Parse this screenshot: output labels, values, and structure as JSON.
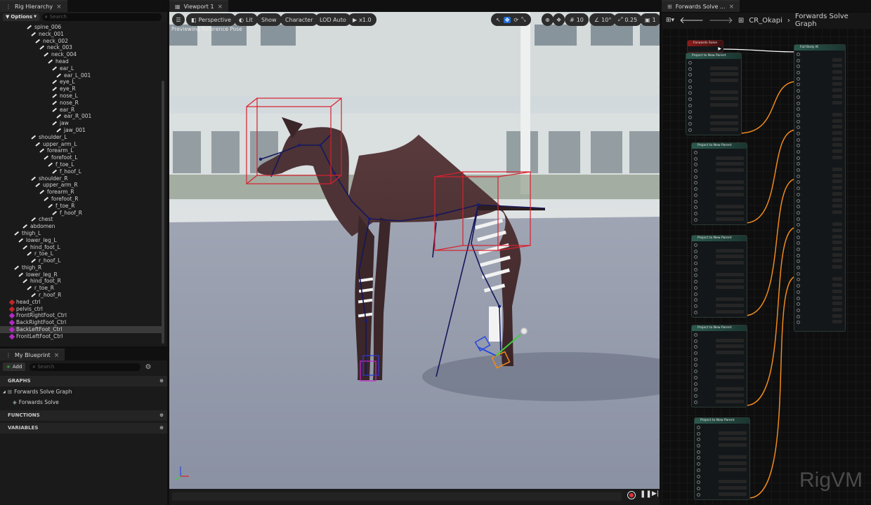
{
  "rig_hierarchy": {
    "tab_label": "Rig Hierarchy",
    "options_label": "Options",
    "search_placeholder": "Search",
    "bones": [
      {
        "label": "spine_006",
        "indent": 38
      },
      {
        "label": "neck_001",
        "indent": 44
      },
      {
        "label": "neck_002",
        "indent": 50
      },
      {
        "label": "neck_003",
        "indent": 56
      },
      {
        "label": "neck_004",
        "indent": 62
      },
      {
        "label": "head",
        "indent": 68
      },
      {
        "label": "ear_L",
        "indent": 74
      },
      {
        "label": "ear_L_001",
        "indent": 80
      },
      {
        "label": "eye_L",
        "indent": 74
      },
      {
        "label": "eye_R",
        "indent": 74
      },
      {
        "label": "nose_L",
        "indent": 74
      },
      {
        "label": "nose_R",
        "indent": 74
      },
      {
        "label": "ear_R",
        "indent": 74
      },
      {
        "label": "ear_R_001",
        "indent": 80
      },
      {
        "label": "jaw",
        "indent": 74
      },
      {
        "label": "jaw_001",
        "indent": 80
      },
      {
        "label": "shoulder_L",
        "indent": 44
      },
      {
        "label": "upper_arm_L",
        "indent": 50
      },
      {
        "label": "forearm_L",
        "indent": 56
      },
      {
        "label": "forefoot_L",
        "indent": 62
      },
      {
        "label": "f_toe_L",
        "indent": 68
      },
      {
        "label": "f_hoof_L",
        "indent": 74
      },
      {
        "label": "shoulder_R",
        "indent": 44
      },
      {
        "label": "upper_arm_R",
        "indent": 50
      },
      {
        "label": "forearm_R",
        "indent": 56
      },
      {
        "label": "forefoot_R",
        "indent": 62
      },
      {
        "label": "f_toe_R",
        "indent": 68
      },
      {
        "label": "f_hoof_R",
        "indent": 74
      },
      {
        "label": "chest",
        "indent": 44
      },
      {
        "label": "abdomen",
        "indent": 32
      },
      {
        "label": "thigh_L",
        "indent": 20
      },
      {
        "label": "lower_leg_L",
        "indent": 26
      },
      {
        "label": "hind_foot_L",
        "indent": 32
      },
      {
        "label": "r_toe_L",
        "indent": 38
      },
      {
        "label": "r_hoof_L",
        "indent": 44
      },
      {
        "label": "thigh_R",
        "indent": 20
      },
      {
        "label": "lower_leg_R",
        "indent": 26
      },
      {
        "label": "hind_foot_R",
        "indent": 32
      },
      {
        "label": "r_toe_R",
        "indent": 38
      },
      {
        "label": "r_hoof_R",
        "indent": 44
      }
    ],
    "controls": [
      {
        "label": "head_ctrl",
        "color": "#c0262b",
        "selected": false
      },
      {
        "label": "pelvis_ctrl",
        "color": "#c0262b",
        "selected": false
      },
      {
        "label": "FrontRightFoot_Ctrl",
        "color": "#b02ac0",
        "selected": false
      },
      {
        "label": "BackRightFoot_Ctrl",
        "color": "#b02ac0",
        "selected": false
      },
      {
        "label": "BackLeftFoot_Ctrl",
        "color": "#b02ac0",
        "selected": true
      },
      {
        "label": "FrontLeftFoot_Ctrl",
        "color": "#b02ac0",
        "selected": false
      }
    ]
  },
  "my_blueprint": {
    "tab_label": "My Blueprint",
    "add_label": "Add",
    "search_placeholder": "Search",
    "graphs_label": "GRAPHS",
    "graph_item": "Forwards Solve Graph",
    "graph_child": "Forwards Solve",
    "functions_label": "FUNCTIONS",
    "variables_label": "VARIABLES"
  },
  "viewport": {
    "tab_label": "Viewport 1",
    "perspective": "Perspective",
    "lit": "Lit",
    "show": "Show",
    "character": "Character",
    "lod": "LOD Auto",
    "play_rate": "x1.0",
    "grid_snap": "10",
    "rotation_snap": "10°",
    "scale_snap": "0.25",
    "camera_speed": "1",
    "preview_text": "Previewing Reference Pose"
  },
  "graph_editor": {
    "tab_label": "Forwards Solve ...",
    "breadcrumb_root": "CR_Okapi",
    "breadcrumb_graph": "Forwards Solve Graph",
    "event_node": "Forwards Solve",
    "fullbody_node": "Full Body IK",
    "project_nodes": [
      "Project to New Parent",
      "Project to New Parent",
      "Project to New Parent",
      "Project to New Parent",
      "Project to New Parent"
    ],
    "watermark": "RigVM"
  },
  "colors": {
    "accent": "#1b8a7b",
    "control_red": "#c0262b",
    "control_magenta": "#b02ac0",
    "wire_orange": "#f08a1c",
    "bbox_red": "#d8212e"
  }
}
